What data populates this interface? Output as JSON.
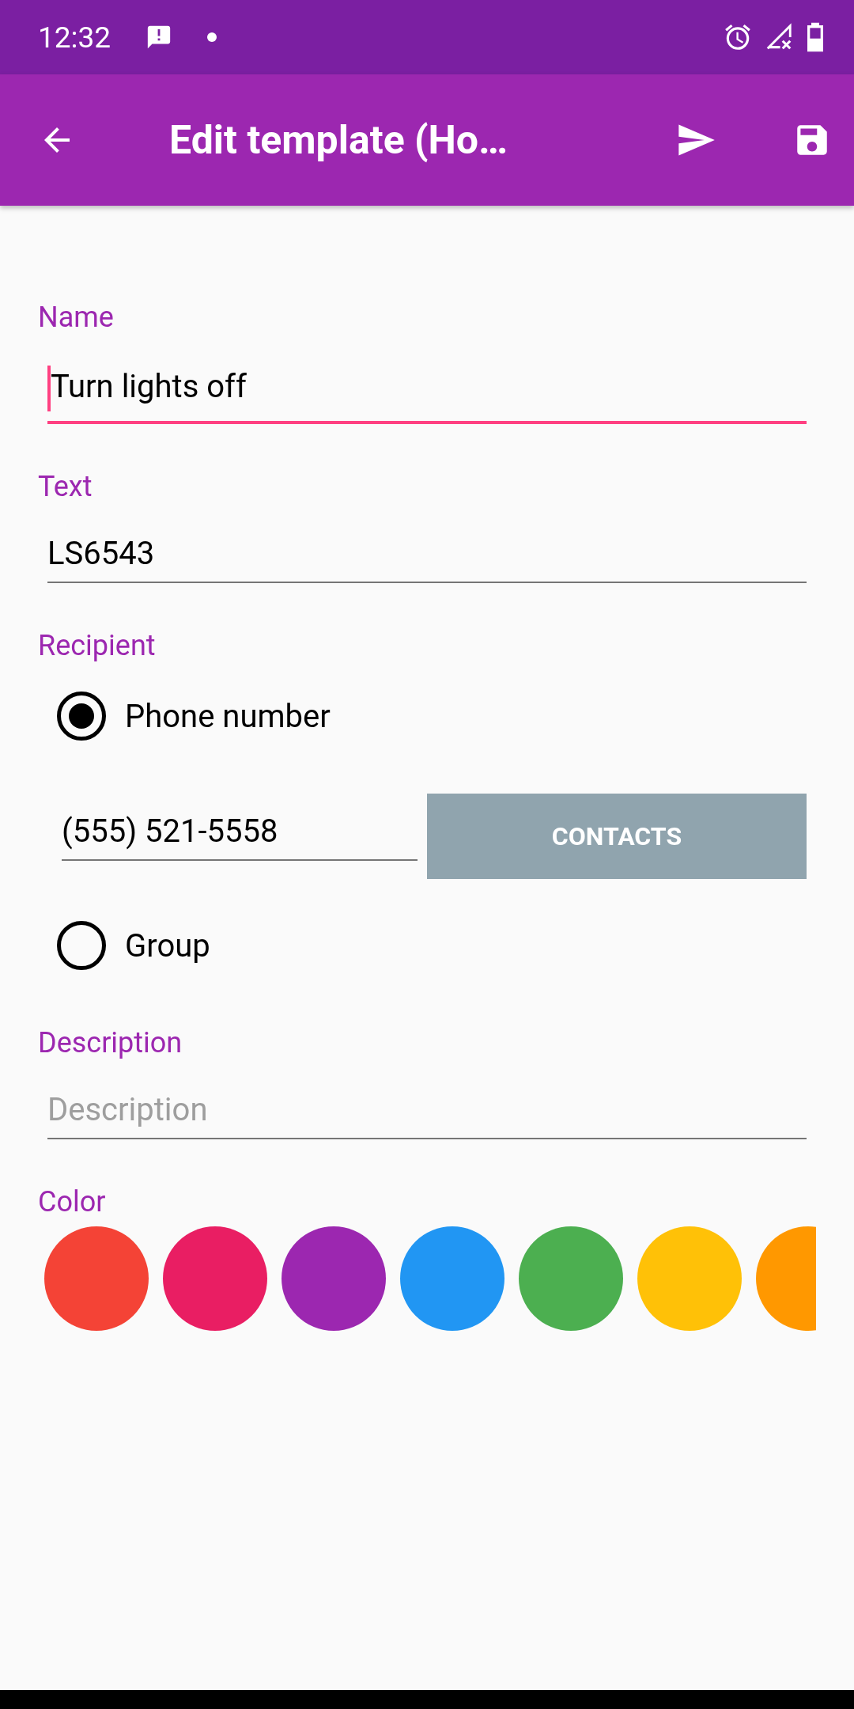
{
  "status_bar": {
    "time": "12:32"
  },
  "app_bar": {
    "title": "Edit template (Ho…"
  },
  "name": {
    "label": "Name",
    "value": "Turn lights off",
    "focused": true
  },
  "text": {
    "label": "Text",
    "value": "LS6543",
    "focused": false
  },
  "recipient": {
    "label": "Recipient",
    "options": [
      {
        "label": "Phone number",
        "selected": true,
        "phone": "(555) 521-5558",
        "button": "CONTACTS"
      },
      {
        "label": "Group",
        "selected": false
      }
    ]
  },
  "description": {
    "label": "Description",
    "placeholder": "Description",
    "focused": false
  },
  "color": {
    "label": "Color",
    "swatches": [
      {
        "color": "#f44336"
      },
      {
        "color": "#e91e63"
      },
      {
        "color": "#9c27b0"
      },
      {
        "color": "#2196f3"
      },
      {
        "color": "#4caf50"
      },
      {
        "color": "#ffc107"
      },
      {
        "color": "#ff9800"
      }
    ]
  }
}
